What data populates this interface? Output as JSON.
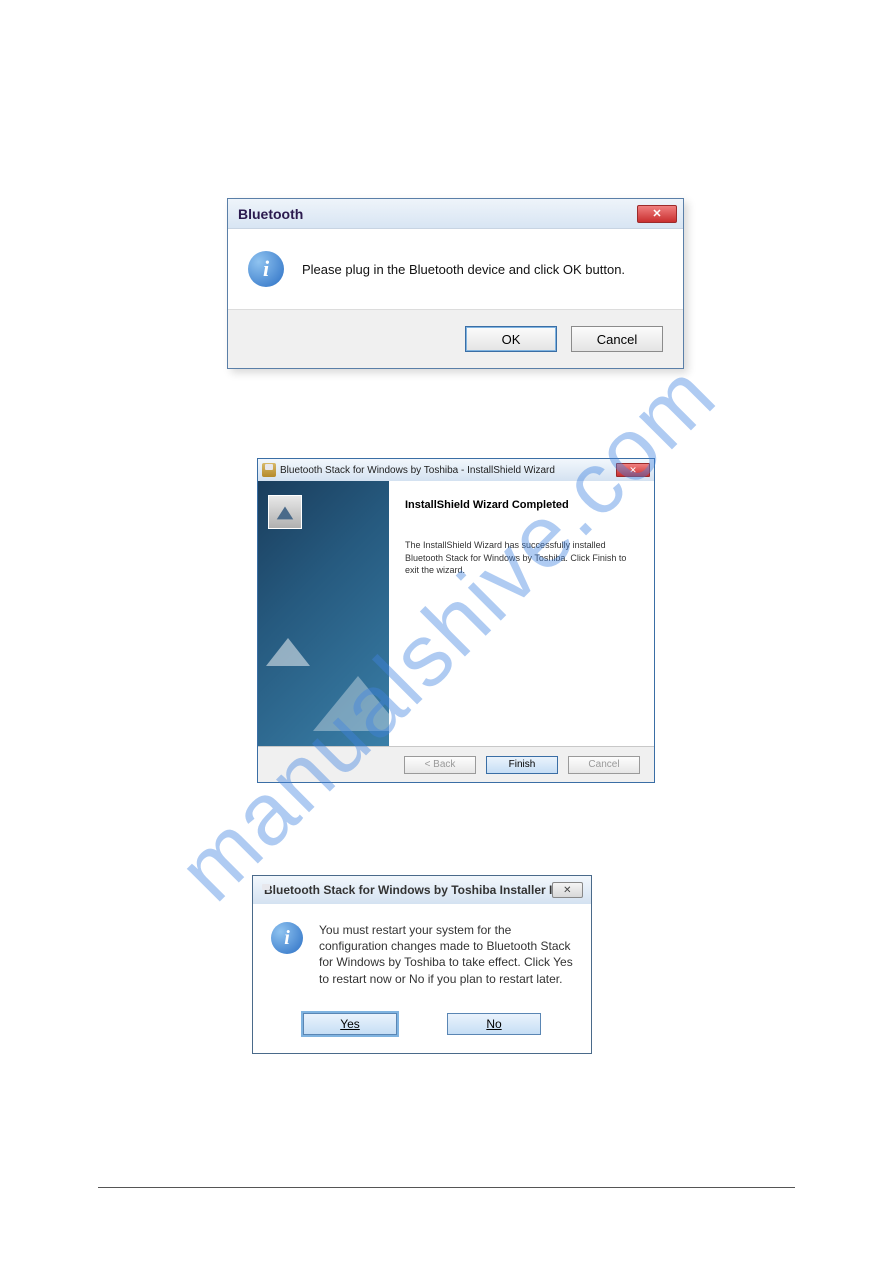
{
  "watermark": "manualshive.com",
  "dialog1": {
    "title": "Bluetooth",
    "close_glyph": "✕",
    "info_glyph": "i",
    "message": "Please plug in the Bluetooth device and click OK button.",
    "ok_label": "OK",
    "cancel_label": "Cancel"
  },
  "dialog2": {
    "title": "Bluetooth Stack for Windows by Toshiba - InstallShield Wizard",
    "close_glyph": "✕",
    "heading": "InstallShield Wizard Completed",
    "text": "The InstallShield Wizard has successfully installed Bluetooth Stack for Windows by Toshiba. Click Finish to exit the wizard.",
    "back_label": "< Back",
    "finish_label": "Finish",
    "cancel_label": "Cancel"
  },
  "dialog3": {
    "title": "Bluetooth Stack for Windows by Toshiba Installer Infor...",
    "close_glyph": "✕",
    "info_glyph": "i",
    "message": "You must restart your system for the configuration changes made to Bluetooth Stack for Windows by Toshiba to take effect. Click Yes to restart now or No if you plan to restart later.",
    "yes_label": "Yes",
    "no_label": "No"
  }
}
